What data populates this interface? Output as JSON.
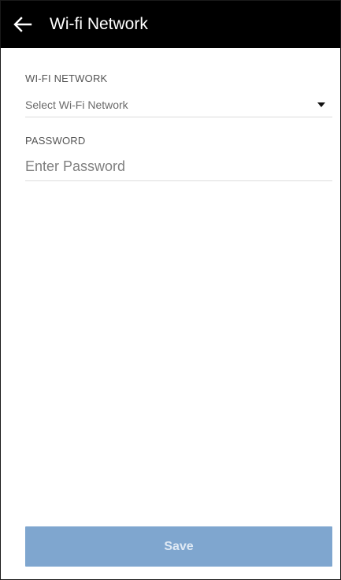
{
  "header": {
    "back_icon": "arrow-left-icon",
    "title": "Wi-fi Network"
  },
  "form": {
    "wifi": {
      "label": "WI-FI NETWORK",
      "selected_value": "Select Wi-Fi Network",
      "dropdown_icon": "caret-down-icon"
    },
    "password": {
      "label": "PASSWORD",
      "value": "",
      "placeholder": "Enter Password"
    }
  },
  "actions": {
    "save_label": "Save"
  },
  "colors": {
    "header_bg": "#000000",
    "save_bg": "#7fa6cf",
    "save_text": "#dfe9f4",
    "divider": "#dcdcdc"
  }
}
